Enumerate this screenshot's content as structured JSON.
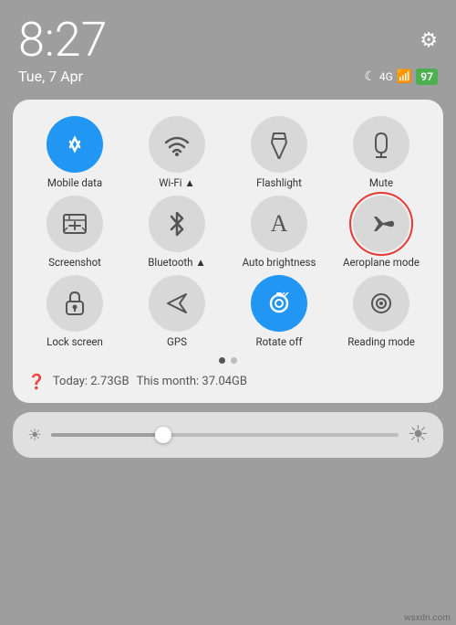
{
  "statusBar": {
    "time": "8:27",
    "date": "Tue, 7 Apr",
    "settingsIcon": "⚙",
    "moonIcon": "☾",
    "signalText": "4G",
    "batteryText": "97"
  },
  "panel": {
    "tiles": [
      {
        "id": "mobile-data",
        "label": "Mobile data",
        "icon": "⇅",
        "active": true
      },
      {
        "id": "wifi",
        "label": "Wi-Fi ▲",
        "icon": "📶",
        "active": false
      },
      {
        "id": "flashlight",
        "label": "Flashlight",
        "icon": "🔦",
        "active": false
      },
      {
        "id": "mute",
        "label": "Mute",
        "icon": "🔔",
        "active": false
      },
      {
        "id": "screenshot",
        "label": "Screenshot",
        "icon": "✂",
        "active": false
      },
      {
        "id": "bluetooth",
        "label": "Bluetooth ▲",
        "icon": "✦",
        "active": false
      },
      {
        "id": "auto-brightness",
        "label": "Auto brightness",
        "icon": "A",
        "active": false
      },
      {
        "id": "aeroplane-mode",
        "label": "Aeroplane mode",
        "icon": "✈",
        "active": false,
        "highlighted": true
      },
      {
        "id": "lock-screen",
        "label": "Lock screen",
        "icon": "🔒",
        "active": false
      },
      {
        "id": "gps",
        "label": "GPS",
        "icon": "➤",
        "active": false
      },
      {
        "id": "rotate-off",
        "label": "Rotate off",
        "icon": "🔒",
        "active": true
      },
      {
        "id": "reading-mode",
        "label": "Reading mode",
        "icon": "◎",
        "active": false
      }
    ],
    "dots": [
      true,
      false
    ],
    "dataToday": "Today: 2.73GB",
    "dataMonth": "This month: 37.04GB"
  },
  "brightness": {
    "minIcon": "☀",
    "maxIcon": "☀"
  },
  "watermark": "wsxdn.com"
}
